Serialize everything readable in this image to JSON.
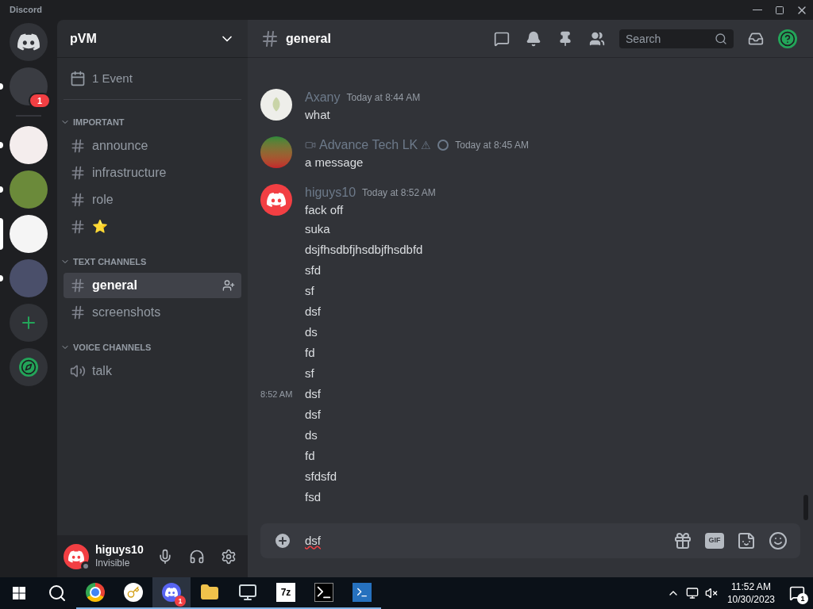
{
  "window": {
    "title": "Discord"
  },
  "servers": [
    {
      "kind": "home",
      "selected": false,
      "unread": false
    },
    {
      "kind": "server",
      "selected": false,
      "unread": true,
      "badge": "1",
      "color": "#3a3c42"
    },
    {
      "kind": "divider"
    },
    {
      "kind": "server",
      "selected": false,
      "unread": true,
      "color": "#f4eded"
    },
    {
      "kind": "server",
      "selected": false,
      "unread": true,
      "color": "#6b8a3a"
    },
    {
      "kind": "server",
      "selected": true,
      "unread": false,
      "color": "#f5f5f5"
    },
    {
      "kind": "server",
      "selected": false,
      "unread": true,
      "color": "#4a4f6a"
    },
    {
      "kind": "add"
    },
    {
      "kind": "explore"
    }
  ],
  "guild": {
    "name": "pVM",
    "events": "1 Event"
  },
  "categories": [
    {
      "name": "IMPORTANT",
      "channels": [
        {
          "name": "announce",
          "kind": "text",
          "selected": false
        },
        {
          "name": "infrastructure",
          "kind": "text",
          "selected": false
        },
        {
          "name": "role",
          "kind": "text",
          "selected": false
        },
        {
          "name": "⭐",
          "kind": "text",
          "selected": false
        }
      ]
    },
    {
      "name": "TEXT CHANNELS",
      "channels": [
        {
          "name": "general",
          "kind": "text",
          "selected": true
        },
        {
          "name": "screenshots",
          "kind": "text",
          "selected": false
        }
      ]
    },
    {
      "name": "VOICE CHANNELS",
      "channels": [
        {
          "name": "talk",
          "kind": "voice",
          "selected": false
        }
      ]
    }
  ],
  "user": {
    "name": "higuys10",
    "status": "Invisible"
  },
  "channel": {
    "name": "general",
    "search_placeholder": "Search"
  },
  "messages": [
    {
      "author": "Axany",
      "avatar": {
        "kind": "leaf"
      },
      "time": "Today at 8:44 AM",
      "lines": [
        {
          "text": "what"
        }
      ]
    },
    {
      "author": "Advance Tech LK",
      "avatar": {
        "kind": "logo"
      },
      "time": "Today at 8:45 AM",
      "decorated": true,
      "suffix": "⚠",
      "lines": [
        {
          "text": "a message"
        }
      ]
    },
    {
      "author": "higuys10",
      "avatar": {
        "kind": "discord"
      },
      "time": "Today at 8:52 AM",
      "lines": [
        {
          "text": "fack off"
        },
        {
          "text": "suka"
        },
        {
          "text": "dsjfhsdbfjhsdbjfhsdbfd"
        },
        {
          "text": "sfd"
        },
        {
          "text": "sf"
        },
        {
          "text": "dsf"
        },
        {
          "text": "ds"
        },
        {
          "text": "fd"
        },
        {
          "text": "sf"
        },
        {
          "text": "dsf",
          "hover_time": "8:52 AM"
        },
        {
          "text": "dsf"
        },
        {
          "text": "ds"
        },
        {
          "text": "fd"
        },
        {
          "text": "sfdsfd"
        },
        {
          "text": "fsd"
        }
      ]
    }
  ],
  "composer": {
    "value": "dsf",
    "gif_label": "GIF"
  },
  "taskbar": {
    "apps": [
      {
        "kind": "chrome",
        "active": false
      },
      {
        "kind": "keys",
        "active": false
      },
      {
        "kind": "discord",
        "active": true,
        "badge": "1"
      },
      {
        "kind": "folder",
        "active": false
      },
      {
        "kind": "monitor",
        "active": false
      },
      {
        "kind": "sevenzip",
        "label": "7z",
        "active": false
      },
      {
        "kind": "terminal",
        "active": false
      },
      {
        "kind": "powershell",
        "active": false
      }
    ],
    "time": "11:52 AM",
    "date": "10/30/2023",
    "notifications": "1"
  }
}
